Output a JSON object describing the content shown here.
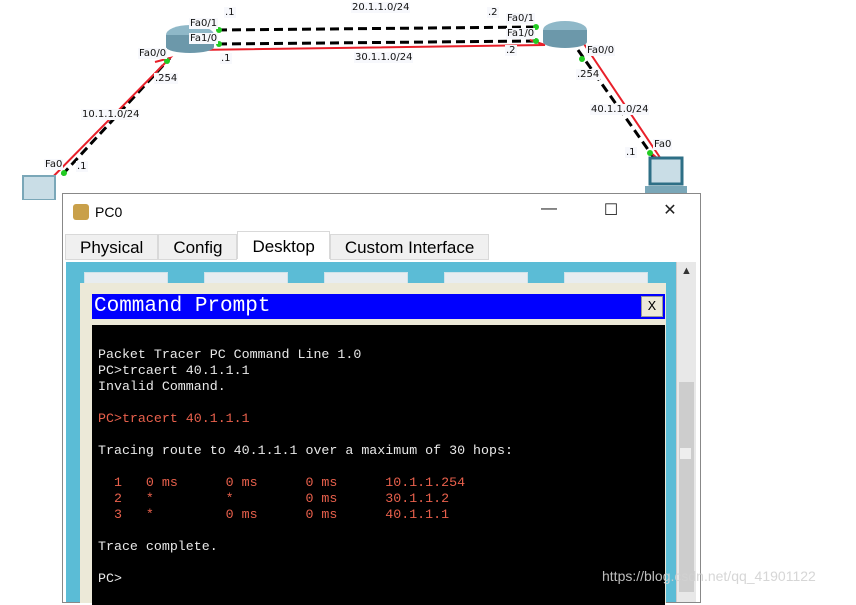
{
  "topology": {
    "labels": [
      {
        "id": "net-20",
        "text": "20.1.1.0/24"
      },
      {
        "id": "net-30",
        "text": "30.1.1.0/24"
      },
      {
        "id": "net-10",
        "text": "10.1.1.0/24"
      },
      {
        "id": "net-40",
        "text": "40.1.1.0/24"
      },
      {
        "id": "r1-fa01",
        "text": "Fa0/1"
      },
      {
        "id": "r1-fa10",
        "text": "Fa1/0"
      },
      {
        "id": "r1-fa00",
        "text": "Fa0/0"
      },
      {
        "id": "r1-fa01-ip",
        "text": ".1"
      },
      {
        "id": "r1-fa10-ip",
        "text": ".1"
      },
      {
        "id": "r1-fa00-ip",
        "text": ".254"
      },
      {
        "id": "r2-fa01",
        "text": "Fa0/1"
      },
      {
        "id": "r2-fa10",
        "text": "Fa1/0"
      },
      {
        "id": "r2-fa00",
        "text": "Fa0/0"
      },
      {
        "id": "r2-fa01-ip",
        "text": ".2"
      },
      {
        "id": "r2-fa10-ip",
        "text": ".2"
      },
      {
        "id": "r2-fa00-ip",
        "text": ".254"
      },
      {
        "id": "pc0-fa0",
        "text": "Fa0"
      },
      {
        "id": "pc0-ip",
        "text": ".1"
      },
      {
        "id": "pc1-fa0",
        "text": "Fa0"
      },
      {
        "id": "pc1-ip",
        "text": ".1"
      }
    ],
    "link_color": "#000000",
    "path_color": "#e8202a",
    "port_color": "#22cc22"
  },
  "window": {
    "title": "PC0",
    "minimize": "—",
    "maximize": "☐",
    "close": "✕",
    "tabs": [
      {
        "label": "Physical"
      },
      {
        "label": "Config"
      },
      {
        "label": "Desktop",
        "active": true
      },
      {
        "label": "Custom Interface"
      }
    ]
  },
  "command_prompt": {
    "title": "Command Prompt",
    "close": "X",
    "lines": [
      {
        "text": "Packet Tracer PC Command Line 1.0",
        "color": "w"
      },
      {
        "text": "PC>trcaert 40.1.1.1",
        "color": "w"
      },
      {
        "text": "Invalid Command.",
        "color": "w"
      },
      {
        "text": "",
        "color": "w"
      },
      {
        "text": "PC>tracert 40.1.1.1",
        "color": "r"
      },
      {
        "text": "",
        "color": "w"
      },
      {
        "text": "Tracing route to 40.1.1.1 over a maximum of 30 hops:",
        "color": "w"
      },
      {
        "text": "",
        "color": "w"
      },
      {
        "text": "  1   0 ms      0 ms      0 ms      10.1.1.254",
        "color": "r"
      },
      {
        "text": "  2   *         *         0 ms      30.1.1.2",
        "color": "r"
      },
      {
        "text": "  3   *         0 ms      0 ms      40.1.1.1",
        "color": "r"
      },
      {
        "text": "",
        "color": "w"
      },
      {
        "text": "Trace complete.",
        "color": "w"
      },
      {
        "text": "",
        "color": "w"
      },
      {
        "text": "PC>",
        "color": "w"
      }
    ]
  },
  "watermark": "https://blog.csdn.net/qq_41901122"
}
